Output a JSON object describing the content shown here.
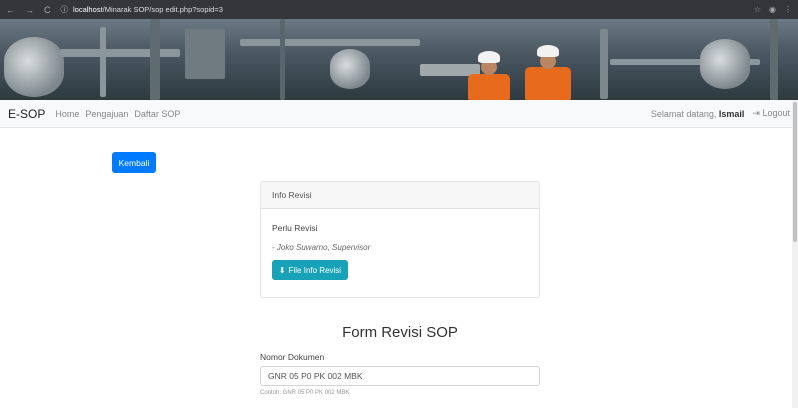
{
  "browser": {
    "back": "←",
    "forward": "→",
    "reload": "C",
    "url_host": "localhost",
    "url_path": "/Minarak SOP/sop edit.php?sopid=3",
    "star": "☆",
    "menu": "⋮"
  },
  "navbar": {
    "brand": "E-SOP",
    "links": [
      "Home",
      "Pengajuan",
      "Daftar SOP"
    ],
    "greeting": "Selamat datang,",
    "user": "Ismail",
    "logout": "Logout"
  },
  "back_button": "Kembali",
  "info_card": {
    "header": "Info Revisi",
    "status": "Perlu Revisi",
    "signature": "- Joko Suwarno, Supervisor",
    "file_button": "File Info Revisi"
  },
  "form": {
    "title": "Form Revisi SOP",
    "nomor_label": "Nomor Dokumen",
    "nomor_value": "GNR 05 P0 PK 002 MBK",
    "nomor_hint": "Contoh: GNR 05 P0 PK 002 MBK"
  },
  "colors": {
    "primary": "#007bff",
    "info": "#17a2b8",
    "chrome": "#35363a"
  }
}
